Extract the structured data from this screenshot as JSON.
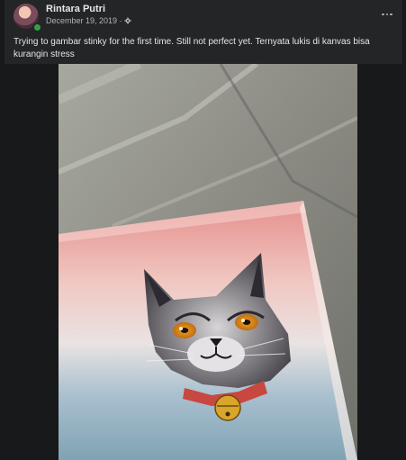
{
  "post": {
    "author": "Rintara Putri",
    "date": "December 19, 2019 · ",
    "privacy_icon": "gear-icon",
    "more_icon": "more-horizontal-icon",
    "text": "Trying to gambar stinky for the first time. Still not perfect yet. Ternyata lukis di kanvas bisa kurangin stress"
  },
  "photo": {
    "subject": "cat-painting-photo",
    "colors": {
      "sky_pink": "#e99892",
      "sky_blue": "#9ab7c8",
      "collar": "#c8473f",
      "bell": "#d9a52a"
    }
  }
}
